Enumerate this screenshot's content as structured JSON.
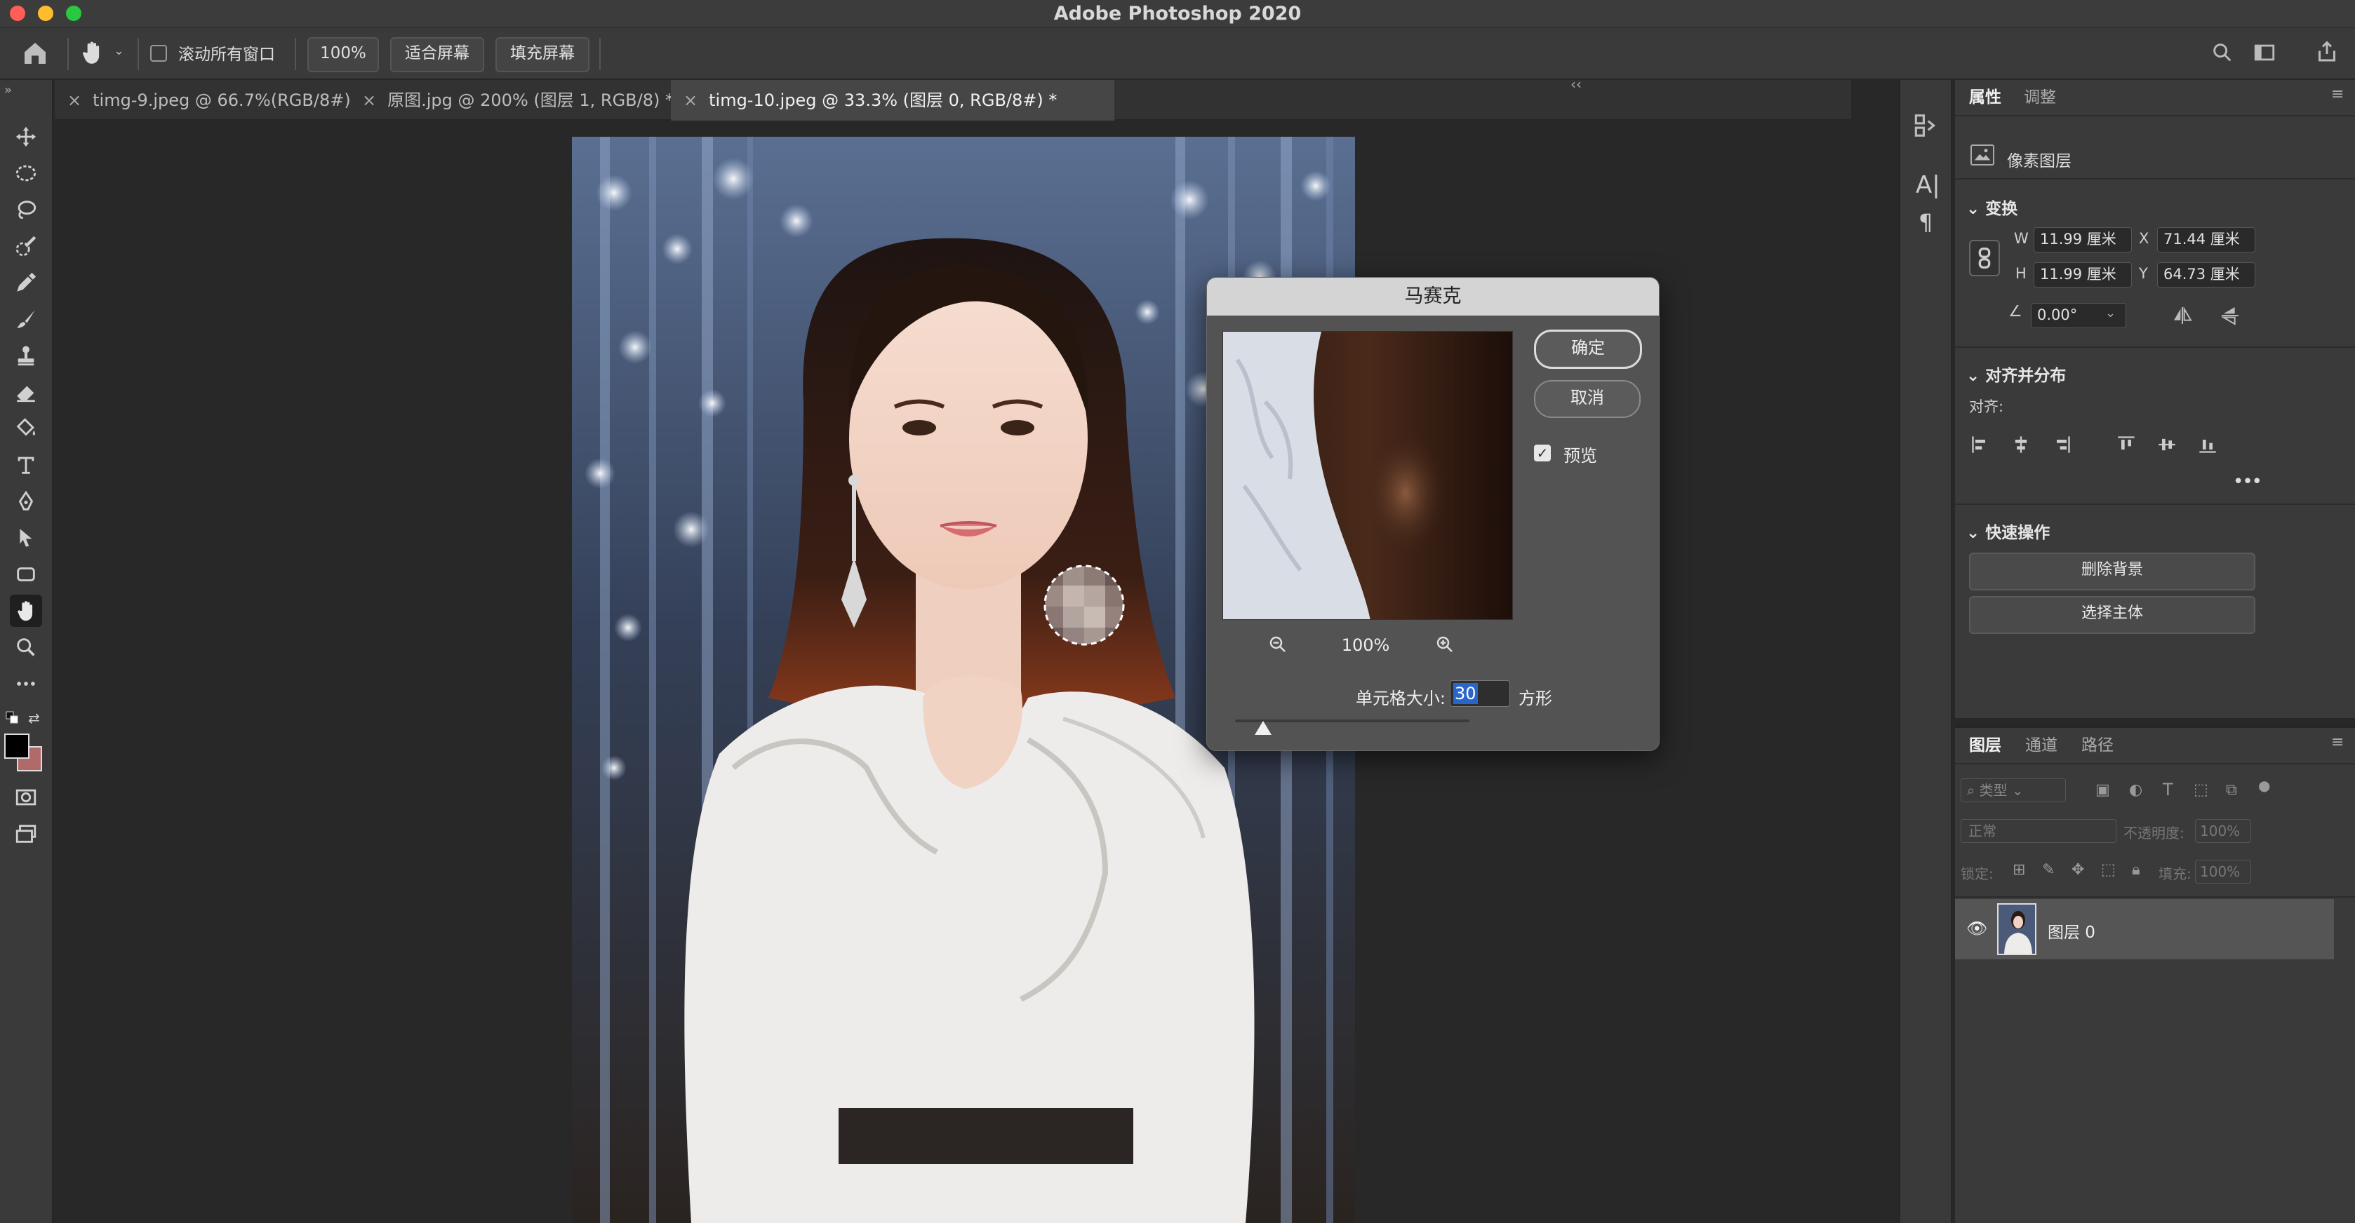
{
  "app": {
    "title": "Adobe Photoshop 2020",
    "traffic_lights": {
      "close": "#ff5f57",
      "minimize": "#febc2e",
      "zoom": "#28c840"
    }
  },
  "options_bar": {
    "home_icon": "home-icon",
    "tool_icon": "hand-icon",
    "scroll_all_label": "滚动所有窗口",
    "zoom_100_label": "100%",
    "fit_screen_label": "适合屏幕",
    "fill_screen_label": "填充屏幕",
    "right_icons": [
      "search-icon",
      "workspace-icon",
      "share-icon"
    ]
  },
  "tabs": [
    {
      "label": "timg-9.jpeg @ 66.7%(RGB/8#)",
      "active": false
    },
    {
      "label": "原图.jpg @ 200% (图层 1, RGB/8) *",
      "active": false
    },
    {
      "label": "timg-10.jpeg @ 33.3% (图层 0, RGB/8#) *",
      "active": true
    }
  ],
  "toolbar": {
    "tools": [
      "move-tool",
      "marquee-tool",
      "lasso-tool",
      "quick-selection-tool",
      "eyedropper-tool",
      "brush-tool",
      "stamp-tool",
      "eraser-tool",
      "paint-bucket-tool",
      "type-tool",
      "pen-tool",
      "path-selection-tool",
      "shape-tool",
      "hand-tool",
      "zoom-tool",
      "more-tools"
    ],
    "selected": "hand-tool",
    "foreground_color": "#000000",
    "background_color": "#b06a6a"
  },
  "mosaic_dialog": {
    "title": "马赛克",
    "ok_label": "确定",
    "cancel_label": "取消",
    "preview_label": "预览",
    "preview_checked": true,
    "zoom_level": "100%",
    "cell_size_label": "单元格大小:",
    "cell_size_value": "30",
    "cell_size_unit": "方形",
    "slider_fraction": 0.12
  },
  "properties_panel": {
    "tabs": [
      "属性",
      "调整"
    ],
    "layer_type": "像素图层",
    "transform_section": "变换",
    "w_label": "W",
    "w_value": "11.99 厘米",
    "x_label": "X",
    "x_value": "71.44 厘米",
    "h_label": "H",
    "h_value": "11.99 厘米",
    "y_label": "Y",
    "y_value": "64.73 厘米",
    "angle_value": "0.00°",
    "align_section": "对齐并分布",
    "align_label": "对齐:",
    "quick_actions_section": "快速操作",
    "remove_bg_label": "删除背景",
    "select_subject_label": "选择主体"
  },
  "layers_panel": {
    "tabs": [
      "图层",
      "通道",
      "路径"
    ],
    "filter_placeholder": "类型",
    "blend_mode": "正常",
    "opacity_label": "不透明度:",
    "opacity_value": "100%",
    "lock_label": "锁定:",
    "fill_label": "填充:",
    "fill_value": "100%",
    "layers": [
      {
        "name": "图层 0",
        "visible": true
      }
    ]
  }
}
